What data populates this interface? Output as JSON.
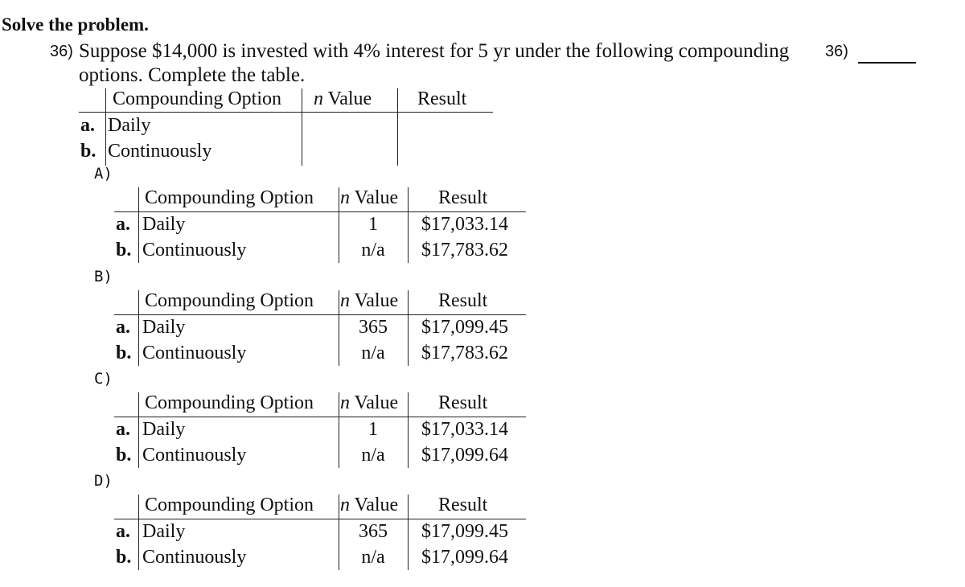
{
  "heading": "Solve the problem.",
  "question": {
    "number": "36)",
    "text_line1": "Suppose $14,000 is invested with 4% interest for 5 yr under the following compounding",
    "text_line2": "options. Complete the table.",
    "answer_label": "36)",
    "answer_blank": ""
  },
  "problem_table": {
    "headers": {
      "option": "Compounding Option",
      "n_symbol": "n",
      "n_label": " Value",
      "result": "Result"
    },
    "rows": [
      {
        "marker": "a.",
        "option": "Daily",
        "n": "",
        "result": ""
      },
      {
        "marker": "b.",
        "option": "Continuously",
        "n": "",
        "result": ""
      }
    ]
  },
  "choices": [
    {
      "label": "A)",
      "headers": {
        "option": "Compounding Option",
        "n_symbol": "n",
        "n_label": " Value",
        "result": "Result"
      },
      "rows": [
        {
          "marker": "a.",
          "option": "Daily",
          "n": "1",
          "result": "$17,033.14"
        },
        {
          "marker": "b.",
          "option": "Continuously",
          "n": "n/a",
          "result": "$17,783.62"
        }
      ]
    },
    {
      "label": "B)",
      "headers": {
        "option": "Compounding Option",
        "n_symbol": "n",
        "n_label": " Value",
        "result": "Result"
      },
      "rows": [
        {
          "marker": "a.",
          "option": "Daily",
          "n": "365",
          "result": "$17,099.45"
        },
        {
          "marker": "b.",
          "option": "Continuously",
          "n": "n/a",
          "result": "$17,783.62"
        }
      ]
    },
    {
      "label": "C)",
      "headers": {
        "option": "Compounding Option",
        "n_symbol": "n",
        "n_label": " Value",
        "result": "Result"
      },
      "rows": [
        {
          "marker": "a.",
          "option": "Daily",
          "n": "1",
          "result": "$17,033.14"
        },
        {
          "marker": "b.",
          "option": "Continuously",
          "n": "n/a",
          "result": "$17,099.64"
        }
      ]
    },
    {
      "label": "D)",
      "headers": {
        "option": "Compounding Option",
        "n_symbol": "n",
        "n_label": " Value",
        "result": "Result"
      },
      "rows": [
        {
          "marker": "a.",
          "option": "Daily",
          "n": "365",
          "result": "$17,099.45"
        },
        {
          "marker": "b.",
          "option": "Continuously",
          "n": "n/a",
          "result": "$17,099.64"
        }
      ]
    }
  ]
}
